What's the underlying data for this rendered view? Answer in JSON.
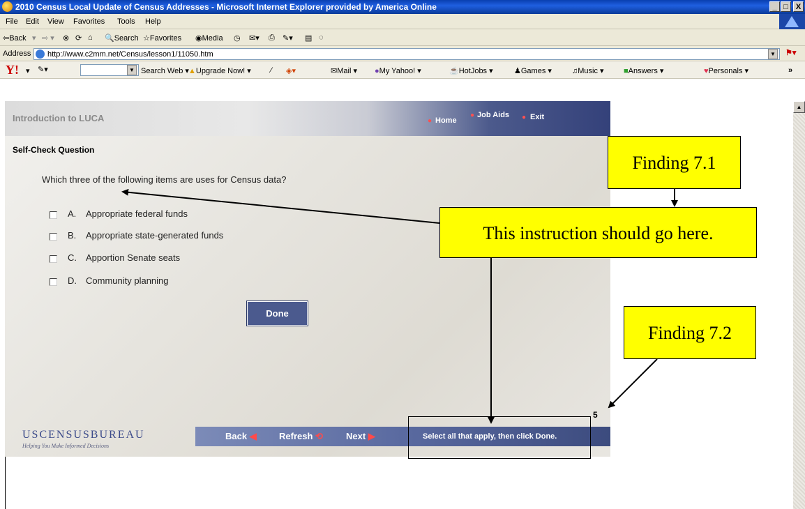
{
  "window": {
    "title": "2010 Census Local Update of Census Addresses - Microsoft Internet Explorer provided by America Online",
    "min": "_",
    "max": "□",
    "close": "X"
  },
  "menu": [
    "File",
    "Edit",
    "View",
    "Favorites",
    "Tools",
    "Help"
  ],
  "toolbar": {
    "back": "⇦Back",
    "search": "Search",
    "favorites": "Favorites",
    "media": "Media"
  },
  "address": {
    "label": "Address",
    "url": "http://www.c2mm.net/Census/lesson1/11050.htm"
  },
  "yahoo": {
    "logo": "Y!",
    "search_web": "Search Web",
    "items": [
      "Upgrade Now!",
      "Mail",
      "My Yahoo!",
      "HotJobs",
      "Games",
      "Music",
      "Answers",
      "Personals"
    ],
    "more": "»"
  },
  "page": {
    "course_title": "Introduction to LUCA",
    "nav_home": "Home",
    "nav_job_aids": "Job Aids",
    "nav_exit": "Exit",
    "section_title": "Self-Check Question",
    "question": "Which three of the following items are uses for Census data?",
    "options": [
      {
        "letter": "A.",
        "text": "Appropriate federal funds"
      },
      {
        "letter": "B.",
        "text": "Appropriate state-generated funds"
      },
      {
        "letter": "C.",
        "text": "Apportion Senate seats"
      },
      {
        "letter": "D.",
        "text": "Community planning"
      }
    ],
    "done_label": "Done",
    "page_number": "5",
    "logo": "USCENSUSBUREAU",
    "tagline": "Helping You Make Informed Decisions",
    "back_label": "Back",
    "refresh_label": "Refresh",
    "next_label": "Next",
    "instruction": "Select all that apply, then click Done."
  },
  "callouts": {
    "finding1": "Finding 7.1",
    "instruction_note": "This instruction should go here.",
    "finding2": "Finding 7.2"
  },
  "colors": {
    "callout_fill": "#ffff00",
    "nav_bar": "#5a6aa0",
    "done_button": "#4b5a8e"
  }
}
